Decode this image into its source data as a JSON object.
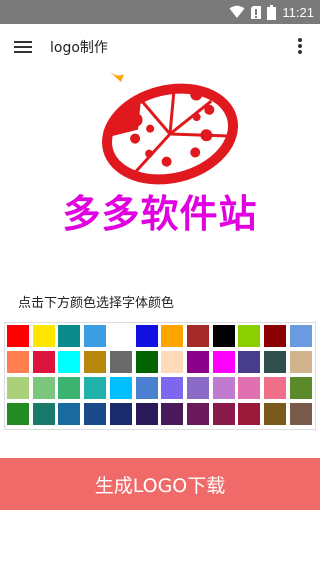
{
  "status_bar": {
    "time": "11:21"
  },
  "toolbar": {
    "title": "logo制作"
  },
  "logo": {
    "text": "多多软件站",
    "text_color": "#e000e0",
    "emblem_color": "#e0191f"
  },
  "palette": {
    "hint": "点击下方颜色选择字体颜色",
    "rows": [
      [
        "#ff0000",
        "#ffe600",
        "#0a8a8a",
        "#3a9ee0",
        "#ffffff",
        "#1010e0",
        "#ffa500",
        "#a52a2a",
        "#000000",
        "#8ad000",
        "#8a0000",
        "#6a9ae0"
      ],
      [
        "#ff7f50",
        "#dc143c",
        "#00ffff",
        "#b8860b",
        "#696969",
        "#006400",
        "#ffdab9",
        "#8b008b",
        "#ff00ff",
        "#483d8b",
        "#2f4f4f",
        "#d2b48c"
      ],
      [
        "#aad07a",
        "#7cc57c",
        "#3cb371",
        "#20b2aa",
        "#00bfff",
        "#4a80d0",
        "#7b68ee",
        "#8a6cc8",
        "#c07ad0",
        "#e070b0",
        "#f0708a",
        "#5a8a2a"
      ],
      [
        "#228b22",
        "#1a7a6a",
        "#1a6aa0",
        "#1a4a8a",
        "#1a2a6a",
        "#2a1a5a",
        "#4a1a5a",
        "#6a1a5a",
        "#8a1a4a",
        "#9a1a3a",
        "#7a5a1a",
        "#7a5a4a"
      ]
    ]
  },
  "generate_button": {
    "label": "生成LOGO下载",
    "color": "#f06a6a"
  }
}
